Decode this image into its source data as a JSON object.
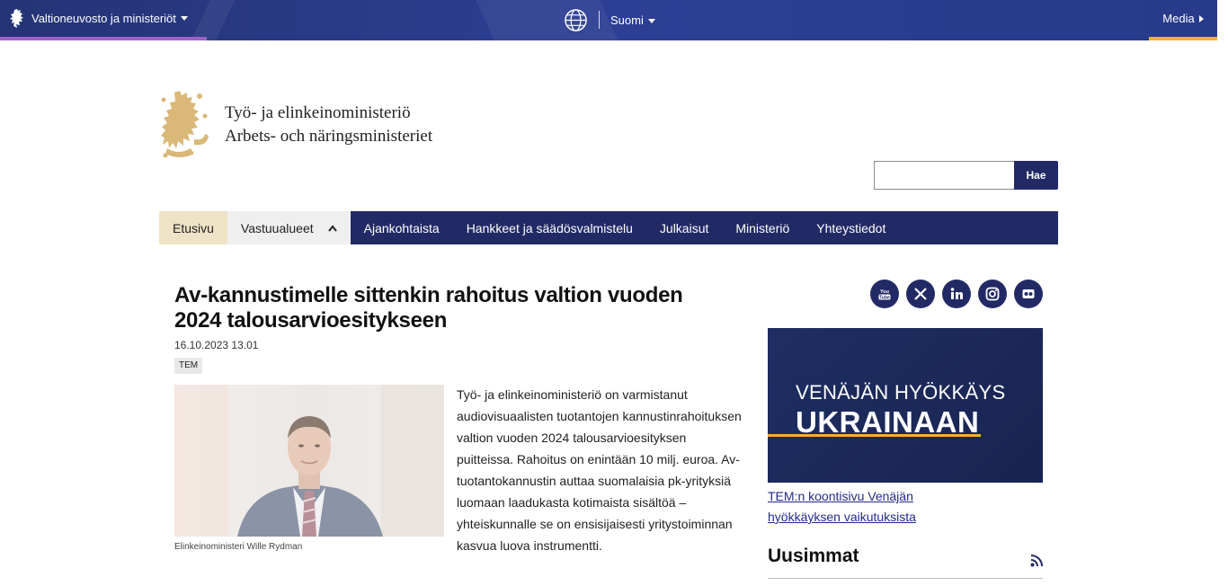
{
  "topbar": {
    "left_label": "Valtioneuvosto ja ministeriöt",
    "language": "Suomi",
    "right_label": "Media"
  },
  "logo": {
    "line1": "Työ- ja elinkeinoministeriö",
    "line2": "Arbets- och näringsministeriet"
  },
  "search": {
    "value": "",
    "button_label": "Hae"
  },
  "nav": {
    "items": [
      {
        "label": "Etusivu"
      },
      {
        "label": "Vastuualueet"
      },
      {
        "label": "Ajankohtaista"
      },
      {
        "label": "Hankkeet ja säädösvalmistelu"
      },
      {
        "label": "Julkaisut"
      },
      {
        "label": "Ministeriö"
      },
      {
        "label": "Yhteystiedot"
      }
    ]
  },
  "article": {
    "title": "Av-kannustimelle sittenkin rahoitus valtion vuoden 2024 talousarvioesitykseen",
    "date": "16.10.2023 13.01",
    "tag": "TEM",
    "image_caption": "Elinkeinoministeri Wille Rydman",
    "body": "Työ- ja elinkeinoministeriö on varmistanut audiovisuaalisten tuotantojen kannustinrahoituksen valtion vuoden 2024 talousarvioesityksen puitteissa. Rahoitus on enintään 10 milj. euroa. Av-tuotantokannustin auttaa suomalaisia pk-yrityksiä luomaan laadukasta kotimaista sisältöä – yhteiskunnalle se on ensisijaisesti yritystoiminnan kasvua luova instrumentti."
  },
  "social": [
    "youtube-icon",
    "x-icon",
    "linkedin-icon",
    "instagram-icon",
    "flickr-icon"
  ],
  "banner": {
    "line1": "VENÄJÄN HYÖKKÄYS",
    "line2": "UKRAINAAN",
    "link": "TEM:n koontisivu Venäjän hyökkäyksen vaikutuksista"
  },
  "latest": {
    "heading": "Uusimmat"
  },
  "colors": {
    "navy": "#222a66",
    "topbar": "#2a3a8c",
    "accent_purple": "#a061c9",
    "accent_yellow": "#f0b323",
    "home_tab": "#efe3c7"
  }
}
